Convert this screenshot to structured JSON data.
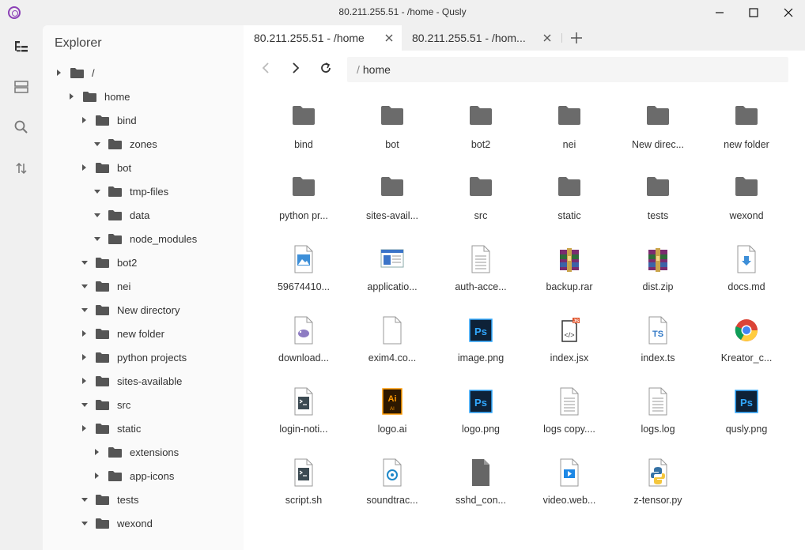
{
  "window": {
    "title": "80.211.255.51 - /home - Qusly"
  },
  "explorer": {
    "title": "Explorer",
    "tree": [
      {
        "label": "/",
        "caret": "right"
      },
      {
        "label": "home",
        "caret": "right"
      },
      {
        "label": "bind",
        "caret": "right"
      },
      {
        "label": "zones",
        "caret": "down"
      },
      {
        "label": "bot",
        "caret": "right"
      },
      {
        "label": "tmp-files",
        "caret": "down"
      },
      {
        "label": "data",
        "caret": "down"
      },
      {
        "label": "node_modules",
        "caret": "down"
      },
      {
        "label": "bot2",
        "caret": "down"
      },
      {
        "label": "nei",
        "caret": "down"
      },
      {
        "label": "New directory",
        "caret": "down"
      },
      {
        "label": "new folder",
        "caret": "right"
      },
      {
        "label": "python projects",
        "caret": "right"
      },
      {
        "label": "sites-available",
        "caret": "right"
      },
      {
        "label": "src",
        "caret": "down"
      },
      {
        "label": "static",
        "caret": "right"
      },
      {
        "label": "extensions",
        "caret": "right"
      },
      {
        "label": "app-icons",
        "caret": "right"
      },
      {
        "label": "tests",
        "caret": "down"
      },
      {
        "label": "wexond",
        "caret": "down"
      }
    ]
  },
  "tabs": [
    {
      "label": "80.211.255.51 - /home",
      "active": true
    },
    {
      "label": "80.211.255.51 - /hom...",
      "active": false
    }
  ],
  "path": {
    "separator": "/",
    "segment": "home"
  },
  "files": [
    {
      "label": "bind",
      "icon": "folder-icon"
    },
    {
      "label": "bot",
      "icon": "folder-icon"
    },
    {
      "label": "bot2",
      "icon": "folder-icon"
    },
    {
      "label": "nei",
      "icon": "folder-icon"
    },
    {
      "label": "New direc...",
      "icon": "folder-icon"
    },
    {
      "label": "new folder",
      "icon": "folder-icon"
    },
    {
      "label": "python pr...",
      "icon": "folder-icon"
    },
    {
      "label": "sites-avail...",
      "icon": "folder-icon"
    },
    {
      "label": "src",
      "icon": "folder-icon"
    },
    {
      "label": "static",
      "icon": "folder-icon"
    },
    {
      "label": "tests",
      "icon": "folder-icon"
    },
    {
      "label": "wexond",
      "icon": "folder-icon"
    },
    {
      "label": "59674410...",
      "icon": "image-file-icon"
    },
    {
      "label": "applicatio...",
      "icon": "window-file-icon"
    },
    {
      "label": "auth-acce...",
      "icon": "text-file-icon"
    },
    {
      "label": "backup.rar",
      "icon": "winrar-icon"
    },
    {
      "label": "dist.zip",
      "icon": "winrar-icon"
    },
    {
      "label": "docs.md",
      "icon": "markdown-file-icon"
    },
    {
      "label": "download...",
      "icon": "php-file-icon"
    },
    {
      "label": "exim4.co...",
      "icon": "blank-file-icon"
    },
    {
      "label": "image.png",
      "icon": "photoshop-icon"
    },
    {
      "label": "index.jsx",
      "icon": "jsx-file-icon"
    },
    {
      "label": "index.ts",
      "icon": "ts-file-icon"
    },
    {
      "label": "Kreator_c...",
      "icon": "chrome-icon"
    },
    {
      "label": "login-noti...",
      "icon": "terminal-file-icon"
    },
    {
      "label": "logo.ai",
      "icon": "illustrator-icon"
    },
    {
      "label": "logo.png",
      "icon": "photoshop-icon"
    },
    {
      "label": "logs copy....",
      "icon": "text-file-icon"
    },
    {
      "label": "logs.log",
      "icon": "text-file-icon"
    },
    {
      "label": "qusly.png",
      "icon": "photoshop-icon"
    },
    {
      "label": "script.sh",
      "icon": "terminal-file-icon"
    },
    {
      "label": "soundtrac...",
      "icon": "audio-file-icon"
    },
    {
      "label": "sshd_con...",
      "icon": "settings-file-icon"
    },
    {
      "label": "video.web...",
      "icon": "video-file-icon"
    },
    {
      "label": "z-tensor.py",
      "icon": "python-file-icon"
    }
  ]
}
